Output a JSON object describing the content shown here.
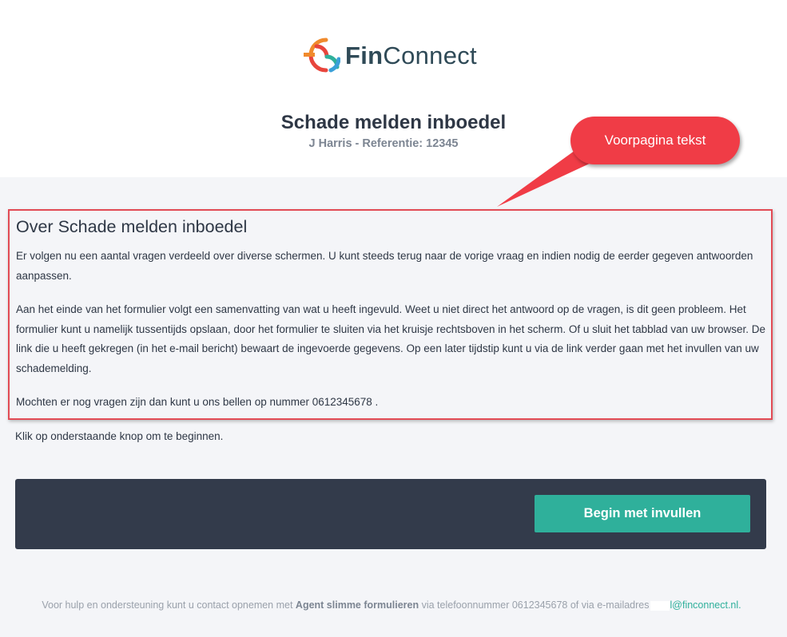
{
  "brand": {
    "name_bold": "Fin",
    "name_regular": "Connect",
    "colors": {
      "orange": "#f08a2c",
      "red": "#e8453c",
      "teal": "#2fb09b",
      "blue": "#3aa0d8",
      "text": "#2f4a57"
    }
  },
  "header": {
    "title": "Schade melden inboedel",
    "subtitle": "J Harris  - Referentie:  12345"
  },
  "annotation": {
    "label": "Voorpagina tekst",
    "color": "#f03c46"
  },
  "intro": {
    "heading": "Over  Schade melden inboedel",
    "paragraphs": [
      "Er volgen nu een aantal vragen verdeeld over diverse schermen. U kunt steeds terug naar de vorige vraag en indien nodig de eerder gegeven antwoorden aanpassen.",
      "Aan het einde van het formulier volgt een samenvatting van wat u heeft ingevuld. Weet u niet direct het antwoord op de vragen, is dit geen probleem. Het formulier kunt u namelijk tussentijds opslaan, door het formulier te sluiten via het kruisje rechtsboven in het scherm. Of u sluit het tabblad van uw browser. De link die u heeft gekregen (in het e-mail bericht) bewaart de ingevoerde gegevens. Op een later tijdstip kunt u via de link verder gaan met het invullen van uw schademelding.",
      "Mochten er nog vragen zijn dan kunt u ons bellen op nummer  0612345678 ."
    ]
  },
  "start_hint": "Klik op onderstaande knop om te beginnen.",
  "action": {
    "begin_label": "Begin met invullen",
    "button_color": "#2fb09b"
  },
  "footer": {
    "prefix": "Voor hulp en ondersteuning kunt u contact opnemen met ",
    "agent": "Agent slimme formulieren",
    "middle": " via telefoonnummer 0612345678 of via e-mailadres",
    "email_suffix": "l@finconnect.nl",
    "end": "."
  }
}
